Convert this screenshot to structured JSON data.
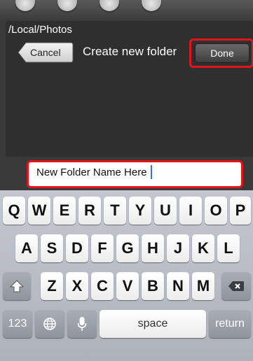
{
  "path": "/Local/Photos",
  "dialog": {
    "title": "Create new folder",
    "cancel_label": "Cancel",
    "done_label": "Done"
  },
  "folder_name": {
    "value": "New Folder Name Here"
  },
  "keyboard": {
    "row1": [
      "Q",
      "W",
      "E",
      "R",
      "T",
      "Y",
      "U",
      "I",
      "O",
      "P"
    ],
    "row2": [
      "A",
      "S",
      "D",
      "F",
      "G",
      "H",
      "J",
      "K",
      "L"
    ],
    "row3": [
      "Z",
      "X",
      "C",
      "V",
      "B",
      "N",
      "M"
    ],
    "numbers_label": "123",
    "space_label": "space",
    "return_label": "return"
  },
  "colors": {
    "highlight": "#e4141c",
    "caret": "#3b6fd9"
  }
}
